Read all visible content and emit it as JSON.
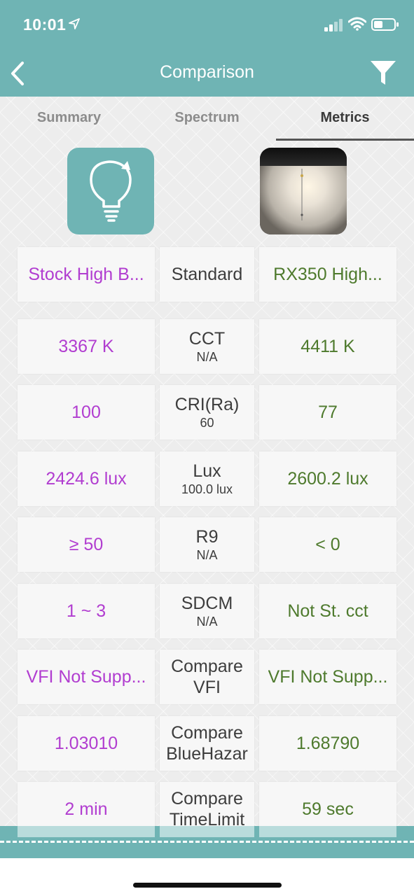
{
  "status_bar": {
    "time": "10:01"
  },
  "header": {
    "title": "Comparison"
  },
  "tabs": [
    {
      "label": "Summary",
      "active": false
    },
    {
      "label": "Spectrum",
      "active": false
    },
    {
      "label": "Metrics",
      "active": true
    }
  ],
  "items": {
    "left": {
      "name": "Stock High B...",
      "icon": "bulb-icon"
    },
    "right": {
      "name": "RX350 High...",
      "icon": "headlight-photo"
    },
    "standard_label": "Standard"
  },
  "metrics": [
    {
      "left": "3367 K",
      "label": "CCT",
      "sub": "N/A",
      "right": "4411 K"
    },
    {
      "left": "100",
      "label": "CRI(Ra)",
      "sub": "60",
      "right": "77"
    },
    {
      "left": "2424.6 lux",
      "label": "Lux",
      "sub": "100.0 lux",
      "right": "2600.2 lux"
    },
    {
      "left": "≥ 50",
      "label": "R9",
      "sub": "N/A",
      "right": "< 0"
    },
    {
      "left": "1 ~ 3",
      "label": "SDCM",
      "sub": "N/A",
      "right": "Not St. cct"
    },
    {
      "left": "VFI Not Supp...",
      "label": "Compare",
      "sub": "VFI",
      "right": "VFI Not Supp..."
    },
    {
      "left": "1.03010",
      "label": "Compare",
      "sub": "BlueHazar",
      "right": "1.68790"
    },
    {
      "left": "2 min",
      "label": "Compare",
      "sub": "TimeLimit",
      "right": "59 sec"
    }
  ],
  "colors": {
    "accent": "#6fb4b4",
    "left_item": "#b13dd0",
    "right_item": "#4e7a2d"
  }
}
